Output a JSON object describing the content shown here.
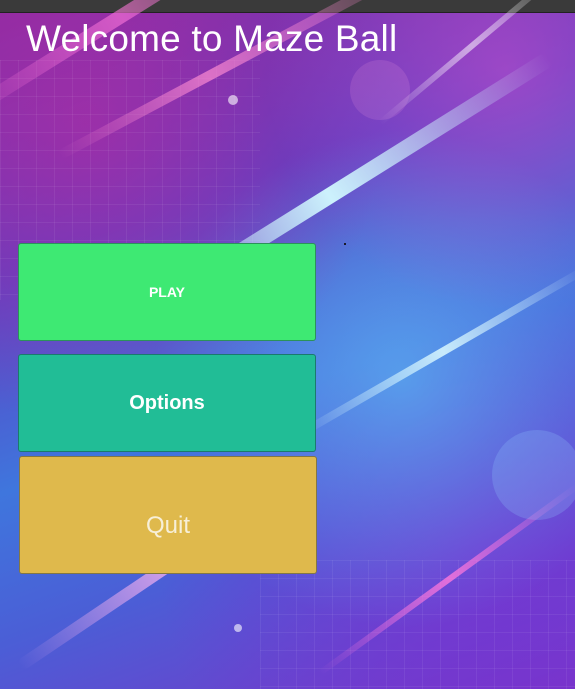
{
  "window": {
    "title_bar": ""
  },
  "menu": {
    "title": "Welcome to Maze Ball",
    "buttons": {
      "play_label": "PLAY",
      "options_label": "Options",
      "quit_label": "Quit"
    }
  },
  "colors": {
    "play_button": "#3ee973",
    "options_button": "#21bd96",
    "quit_button": "#dfb94c",
    "background_primary": "#5d3fc2",
    "background_accent": "#3f76dd"
  }
}
